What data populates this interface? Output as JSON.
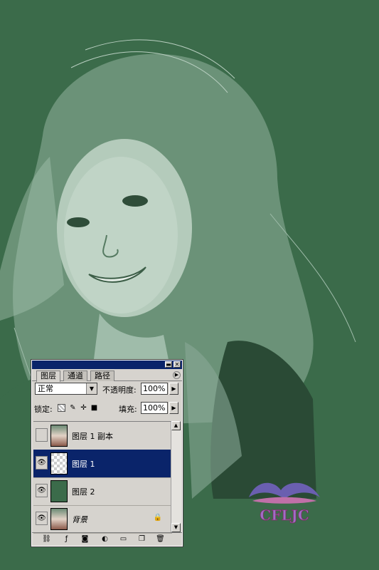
{
  "panel": {
    "tabs": [
      {
        "label": "图层",
        "active": true
      },
      {
        "label": "通道",
        "active": false
      },
      {
        "label": "路径",
        "active": false
      }
    ],
    "blend_mode": "正常",
    "opacity_label": "不透明度:",
    "opacity_value": "100%",
    "lock_label": "锁定:",
    "fill_label": "填充:",
    "fill_value": "100%",
    "layers": [
      {
        "name": "图层 1 副本",
        "visible": false,
        "selected": false,
        "thumb": "photo"
      },
      {
        "name": "图层 1",
        "visible": true,
        "selected": true,
        "thumb": "transparent"
      },
      {
        "name": "图层 2",
        "visible": true,
        "selected": false,
        "thumb": "green"
      },
      {
        "name": "背景",
        "visible": true,
        "selected": false,
        "thumb": "photo",
        "locked": true
      }
    ]
  },
  "watermark": {
    "text": "CFLJC"
  },
  "colors": {
    "canvas_green": "#3b6b4a",
    "highlight": "#0a246a",
    "panel_bg": "#d6d3ce"
  }
}
